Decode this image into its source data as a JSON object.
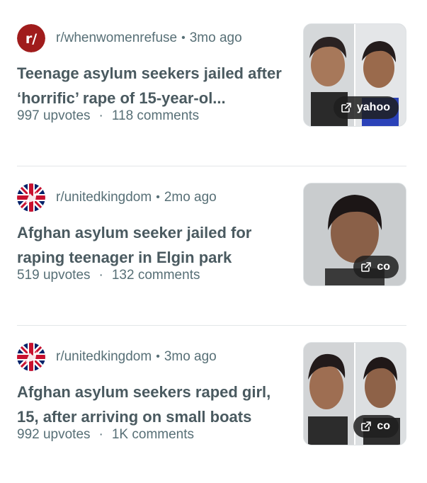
{
  "posts": [
    {
      "subreddit": "r/whenwomenrefuse",
      "age": "3mo ago",
      "title": "Teenage asylum seekers jailed after ‘horrific’ rape of 15-year-ol...",
      "upvotes": "997 upvotes",
      "comments": "118 comments",
      "source": "yahoo",
      "avatar": "rslash-icon"
    },
    {
      "subreddit": "r/unitedkingdom",
      "age": "2mo ago",
      "title": "Afghan asylum seeker jailed for raping teenager in Elgin park",
      "upvotes": "519 upvotes",
      "comments": "132 comments",
      "source": "co",
      "avatar": "uk-flag-icon"
    },
    {
      "subreddit": "r/unitedkingdom",
      "age": "3mo ago",
      "title": "Afghan asylum seekers raped girl, 15, after arriving on small boats",
      "upvotes": "992 upvotes",
      "comments": "1K comments",
      "source": "co",
      "avatar": "uk-flag-icon"
    }
  ],
  "separator": "·",
  "bullet": "•",
  "colors": {
    "text": "#576f76",
    "title": "#4a5a60",
    "reddit_red": "#a01c1c"
  }
}
